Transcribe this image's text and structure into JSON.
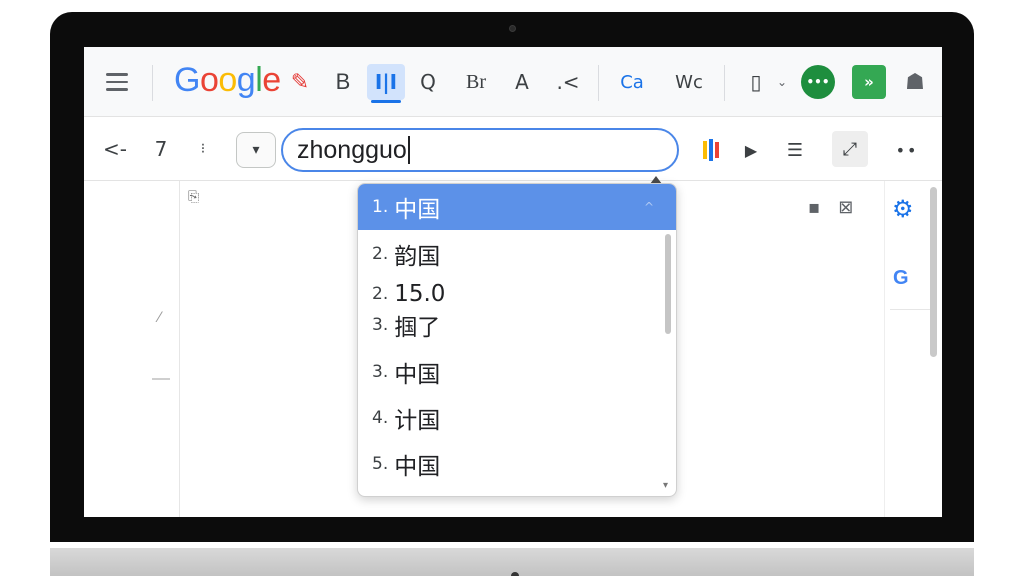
{
  "toolbar": {
    "logo_parts": [
      "G",
      "o",
      "o",
      "g",
      "l",
      "e"
    ],
    "bold_label": "B",
    "format_label": "I|I",
    "q_label": "Q",
    "br_label": "Br",
    "a_label": "A",
    "x_label": ".<",
    "ca_label": "Ca",
    "wc_label": "Wc",
    "chat_label": "•••",
    "forward_label": "»"
  },
  "nav": {
    "back_label": "<-",
    "forward_label": "7",
    "updown_label": "⁝"
  },
  "search": {
    "value": "zhongguo"
  },
  "suggestions": [
    {
      "num": "1.",
      "text": "中国",
      "selected": true
    },
    {
      "num": "2.",
      "text": "韵国"
    },
    {
      "num": "2.",
      "text": "15.0"
    },
    {
      "num": "3.",
      "text": "掴了"
    },
    {
      "num": "3.",
      "text": "中国"
    },
    {
      "num": "4.",
      "text": "计国"
    },
    {
      "num": "5.",
      "text": "中国"
    }
  ],
  "side_panel": {
    "google_badge": "G"
  },
  "colors": {
    "accent": "#1a73e8",
    "selection": "#5c91e8",
    "logo_blue": "#4285f4",
    "logo_red": "#ea4335",
    "logo_yellow": "#fbbc05",
    "logo_green": "#34a853"
  }
}
